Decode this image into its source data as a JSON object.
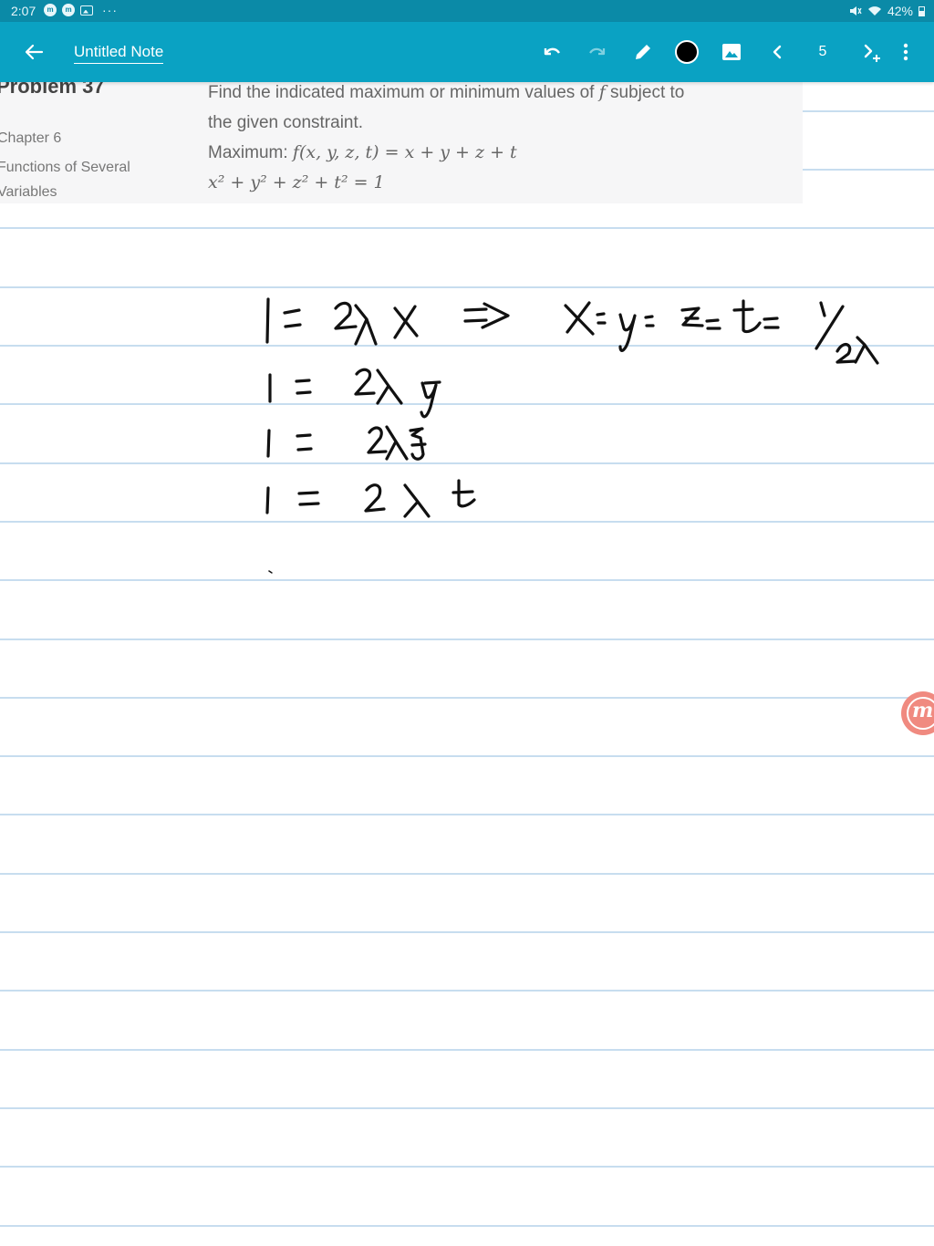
{
  "status_bar": {
    "time": "2:07",
    "dots": "···",
    "battery": "42%"
  },
  "app_bar": {
    "note_title": "Untitled Note",
    "page_number": "5"
  },
  "problem": {
    "title": "Problem 37",
    "chapter": "Chapter 6",
    "chapter_name": "Functions of Several Variables",
    "statement_line1": "Find the indicated maximum or minimum values of",
    "f_symbol": "f",
    "statement_line1_end": "subject to",
    "statement_line2": "the given constraint.",
    "maximum_label": "Maximum:",
    "objective": "f(x, y, z, t) = x + y + z + t",
    "constraint": "x² + y² + z² + t² = 1"
  },
  "icons": {
    "back": "back-arrow-icon",
    "undo": "undo-icon",
    "redo": "redo-icon",
    "pen": "pen-icon",
    "color": "color-dot-icon",
    "image": "image-icon",
    "prev": "chevron-left-icon",
    "next": "next-page-icon",
    "more": "more-vert-icon"
  },
  "colors": {
    "status_bar": "#0b8aa7",
    "app_bar": "#0aa2c3",
    "ruled_line": "#c7ddef",
    "panel": "#f6f6f7",
    "ink": "#111111",
    "fab": "#f08a80"
  }
}
